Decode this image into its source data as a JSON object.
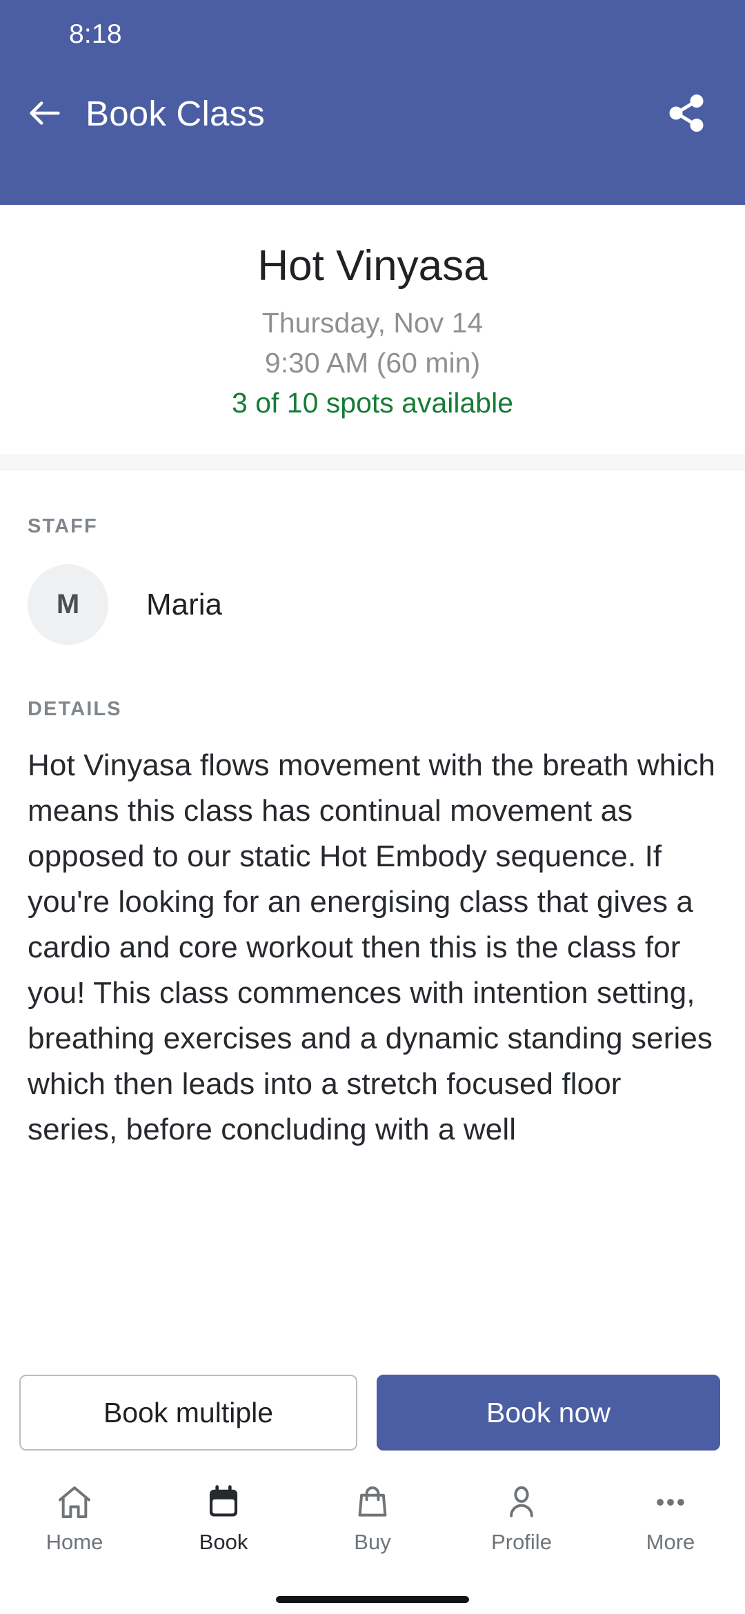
{
  "status_bar": {
    "time": "8:18"
  },
  "app_bar": {
    "title": "Book Class",
    "back_icon": "arrow-left-icon",
    "share_icon": "share-icon",
    "background_color": "#4b5da3"
  },
  "class_summary": {
    "name": "Hot Vinyasa",
    "date": "Thursday, Nov 14",
    "time": "9:30 AM (60 min)",
    "availability": "3 of 10 spots available",
    "availability_color": "#157c36",
    "muted_color": "#8e9194"
  },
  "staff_section": {
    "label": "STAFF",
    "members": [
      {
        "initial": "M",
        "name": "Maria"
      }
    ]
  },
  "details_section": {
    "label": "DETAILS",
    "body": "Hot Vinyasa flows movement with the breath which means this class has continual movement as opposed to our static Hot Embody sequence. If you're looking for an energising class that gives a cardio and core workout then this is the class for you! This class commences with intention setting, breathing exercises and a dynamic standing series which then leads into a stretch focused floor series, before concluding with a well"
  },
  "actions": {
    "secondary_label": "Book multiple",
    "primary_label": "Book now",
    "primary_color": "#4b5da3"
  },
  "bottom_nav": {
    "active_index": 1,
    "items": [
      {
        "label": "Home",
        "icon": "home-icon"
      },
      {
        "label": "Book",
        "icon": "calendar-icon"
      },
      {
        "label": "Buy",
        "icon": "shopping-bag-icon"
      },
      {
        "label": "Profile",
        "icon": "person-icon"
      },
      {
        "label": "More",
        "icon": "more-horizontal-icon"
      }
    ]
  }
}
